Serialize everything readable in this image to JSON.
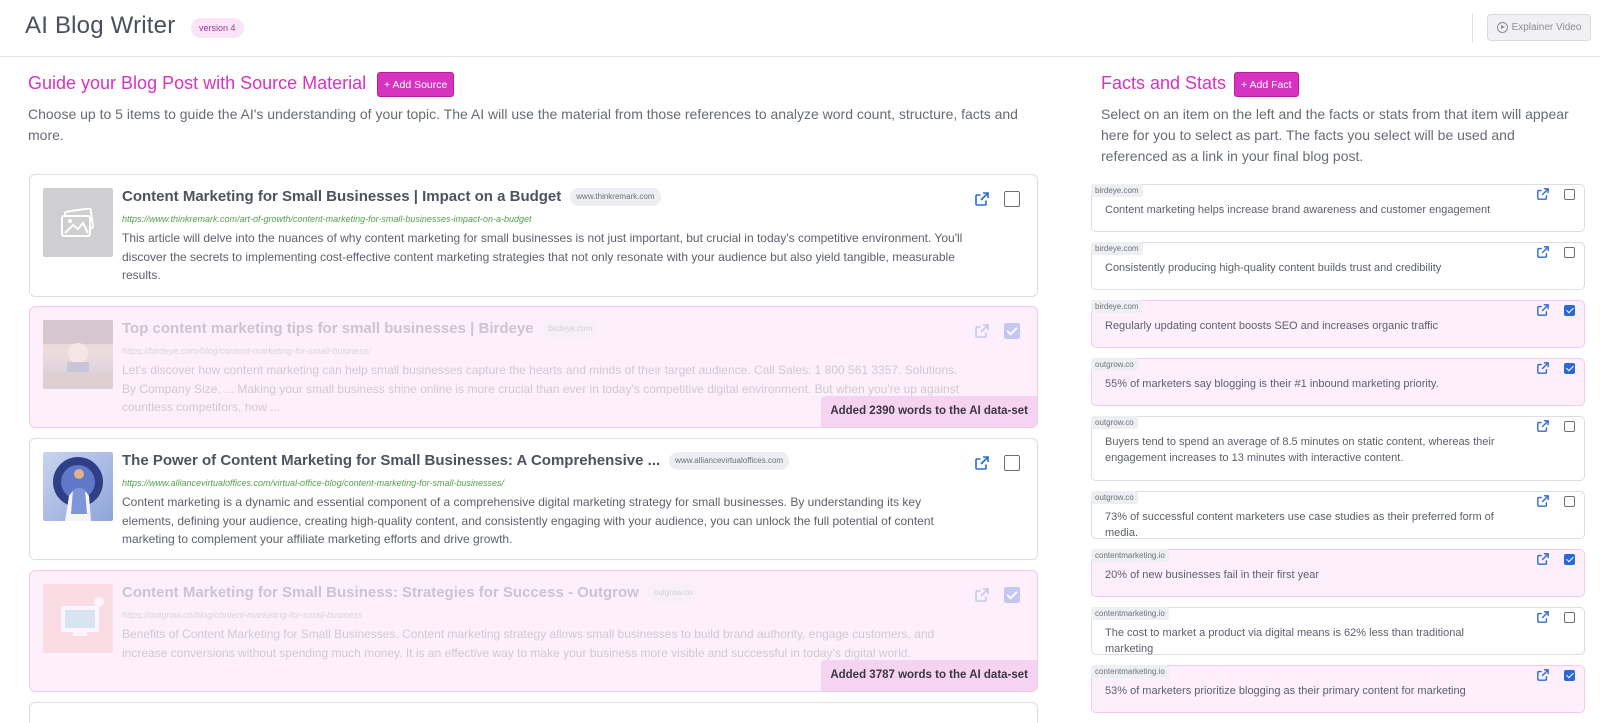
{
  "header": {
    "title": "AI Blog Writer",
    "version": "version 4",
    "explainer_label": "Explainer Video"
  },
  "sources": {
    "title": "Guide your Blog Post with Source Material",
    "add_label": "+ Add Source",
    "description": "Choose up to 5 items to guide the AI's understanding of your topic. The AI will use the material from those references to analyze word count, structure, facts and more.",
    "items": [
      {
        "title": "Content Marketing for Small Businesses | Impact on a Budget",
        "domain": "www.thinkremark.com",
        "url": "https://www.thinkremark.com/art-of-growth/content-marketing-for-small-businesses-impact-on-a-budget",
        "description": "This article will delve into the nuances of why content marketing for small businesses is not just important, but crucial in today's competitive environment. You'll discover the secrets to implementing cost-effective content marketing strategies that not only resonate with your audience but also yield tangible, measurable results.",
        "selected": false,
        "thumb": "placeholder-image-icon"
      },
      {
        "title": "Top content marketing tips for small businesses | Birdeye",
        "domain": "birdeye.com",
        "url": "https://birdeye.com/blog/content-marketing-for-small-business/",
        "description": "Let's discover how content marketing can help small businesses capture the hearts and minds of their target audience. Call Sales: 1 800 561 3357. Solutions. By Company Size. ... Making your small business shine online is more crucial than ever in today's competitive digital environment. But when you're up against countless competitors, how ...",
        "selected": true,
        "added_label": "Added 2390 words to the AI data-set"
      },
      {
        "title": "The Power of Content Marketing for Small Businesses: A Comprehensive ...",
        "domain": "www.alliancevirtualoffices.com",
        "url": "https://www.alliancevirtualoffices.com/virtual-office-blog/content-marketing-for-small-businesses/",
        "description": "Content marketing is a dynamic and essential component of a comprehensive digital marketing strategy for small businesses. By understanding its key elements, defining your audience, creating high-quality content, and consistently engaging with your audience, you can unlock the full potential of content marketing to complement your affiliate marketing efforts and drive growth.",
        "selected": false
      },
      {
        "title": "Content Marketing for Small Business: Strategies for Success - Outgrow",
        "domain": "outgrow.co",
        "url": "https://outgrow.co/blog/content-marketing-for-small-business",
        "description": "Benefits of Content Marketing for Small Businesses. Content marketing strategy allows small businesses to build brand authority, engage customers, and increase conversions without spending much money. It is an effective way to make your business more visible and successful in today's digital world.",
        "selected": true,
        "added_label": "Added 3787 words to the AI data-set"
      }
    ]
  },
  "facts": {
    "title": "Facts and Stats",
    "add_label": "+ Add Fact",
    "description": "Select on an item on the left and the facts or stats from that item will appear here for you to select as part. The facts you select will be used and referenced as a link in your final blog post.",
    "items": [
      {
        "domain": "birdeye.com",
        "text": "Content marketing helps increase brand awareness and customer engagement",
        "selected": false
      },
      {
        "domain": "birdeye.com",
        "text": "Consistently producing high-quality content builds trust and credibility",
        "selected": false
      },
      {
        "domain": "birdeye.com",
        "text": "Regularly updating content boosts SEO and increases organic traffic",
        "selected": true
      },
      {
        "domain": "outgrow.co",
        "text": "55% of marketers say blogging is their #1 inbound marketing priority.",
        "selected": true
      },
      {
        "domain": "outgrow.co",
        "text": "Buyers tend to spend an average of 8.5 minutes on static content, whereas their engagement increases to 13 minutes with interactive content.",
        "selected": false
      },
      {
        "domain": "outgrow.co",
        "text": "73% of successful content marketers use case studies as their preferred form of media.",
        "selected": false
      },
      {
        "domain": "contentmarketing.io",
        "text": "20% of new businesses fail in their first year",
        "selected": true
      },
      {
        "domain": "contentmarketing.io",
        "text": "The cost to market a product via digital means is 62% less than traditional marketing",
        "selected": false
      },
      {
        "domain": "contentmarketing.io",
        "text": "53% of marketers prioritize blogging as their primary content for marketing",
        "selected": true
      }
    ]
  },
  "colors": {
    "accent": "#d633c0",
    "selected_bg": "#fdf0fc",
    "checkbox_on": "#2a68d6",
    "url_green": "#55a04e"
  }
}
